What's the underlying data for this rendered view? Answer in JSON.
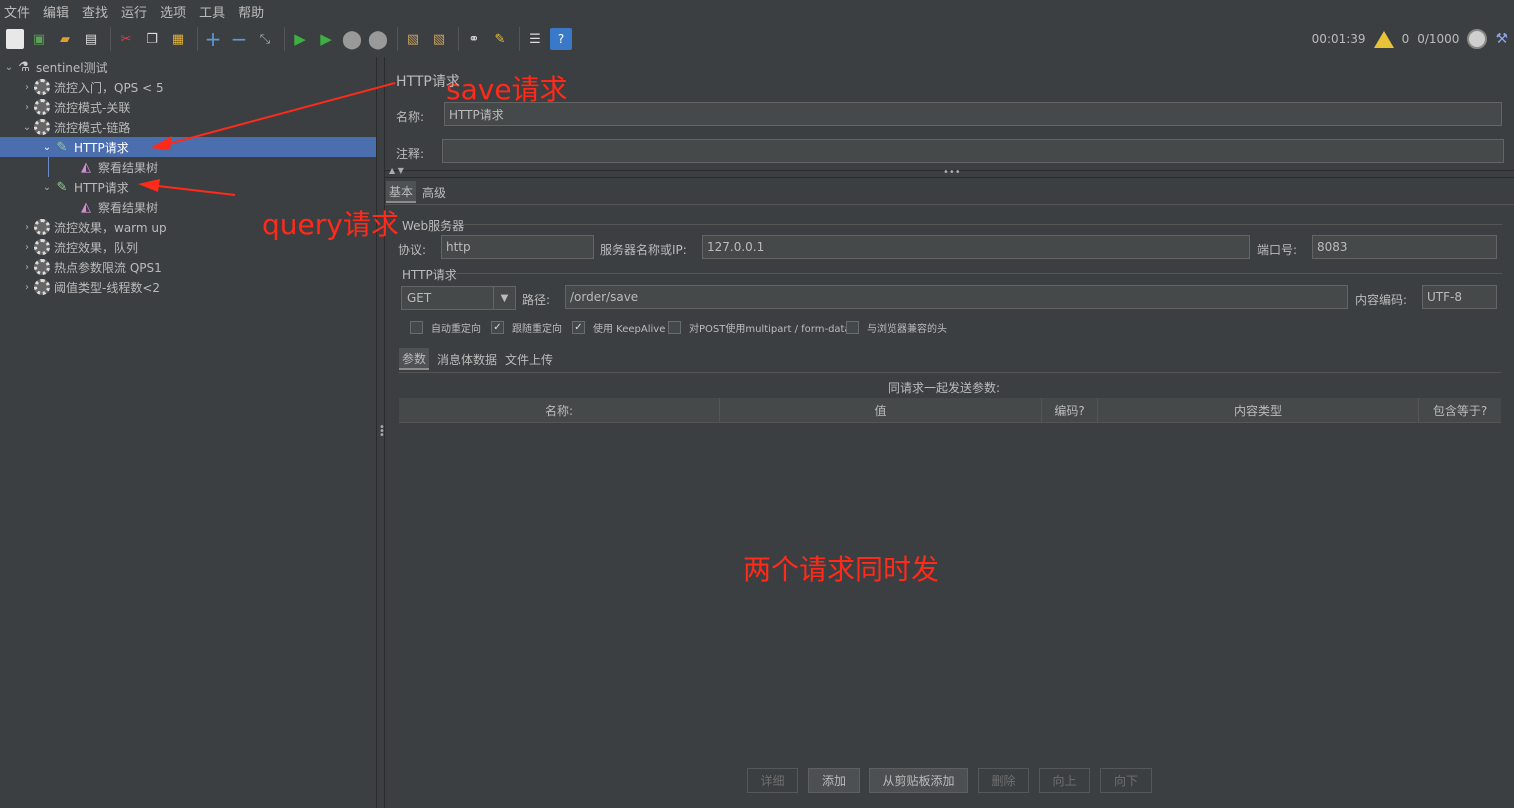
{
  "menu": [
    "文件",
    "编辑",
    "查找",
    "运行",
    "选项",
    "工具",
    "帮助"
  ],
  "toolbar": {
    "timer": "00:01:39",
    "warnings": "0",
    "threads": "0/1000"
  },
  "tree": {
    "root": "sentinel测试",
    "items": [
      "流控入门，QPS < 5",
      "流控模式-关联",
      "流控模式-链路",
      "HTTP请求",
      "察看结果树",
      "HTTP请求",
      "察看结果树",
      "流控效果，warm up",
      "流控效果，队列",
      "热点参数限流 QPS1",
      "阈值类型-线程数<2"
    ]
  },
  "annotations": {
    "save": "save请求",
    "query": "query请求",
    "center": "两个请求同时发"
  },
  "panel": {
    "title": "HTTP请求",
    "name_label": "名称:",
    "name_value": "HTTP请求",
    "comment_label": "注释:",
    "comment_value": "",
    "tabs": [
      "基本",
      "高级"
    ],
    "web_server_group": "Web服务器",
    "protocol_label": "协议:",
    "protocol_value": "http",
    "server_label": "服务器名称或IP:",
    "server_value": "127.0.0.1",
    "port_label": "端口号:",
    "port_value": "8083",
    "http_group": "HTTP请求",
    "method": "GET",
    "path_label": "路径:",
    "path_value": "/order/save",
    "encoding_label": "内容编码:",
    "encoding_value": "UTF-8",
    "checkboxes": [
      {
        "label": "自动重定向",
        "checked": false
      },
      {
        "label": "跟随重定向",
        "checked": true
      },
      {
        "label": "使用 KeepAlive",
        "checked": true
      },
      {
        "label": "对POST使用multipart / form-data",
        "checked": false
      },
      {
        "label": "与浏览器兼容的头",
        "checked": false
      }
    ],
    "sub_tabs": [
      "参数",
      "消息体数据",
      "文件上传"
    ],
    "params_caption": "同请求一起发送参数:",
    "columns": [
      "名称:",
      "值",
      "编码?",
      "内容类型",
      "包含等于?"
    ],
    "buttons": [
      {
        "label": "详细",
        "enabled": false
      },
      {
        "label": "添加",
        "enabled": true
      },
      {
        "label": "从剪贴板添加",
        "enabled": true
      },
      {
        "label": "删除",
        "enabled": false
      },
      {
        "label": "向上",
        "enabled": false
      },
      {
        "label": "向下",
        "enabled": false
      }
    ]
  }
}
